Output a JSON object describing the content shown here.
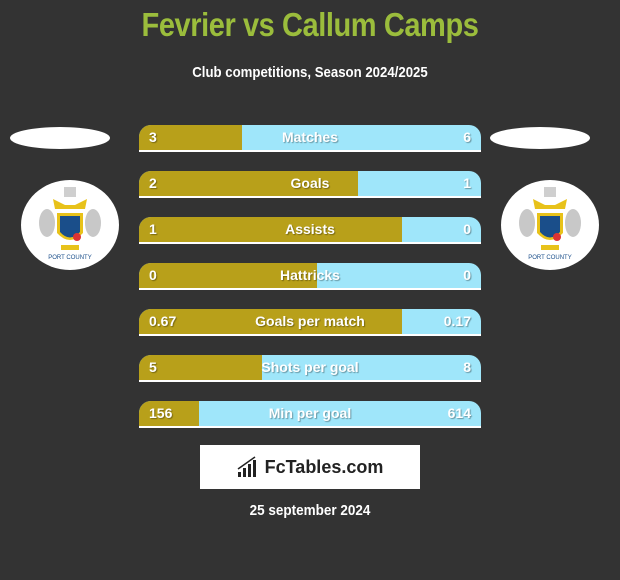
{
  "header": {
    "title": "Fevrier vs Callum Camps",
    "subtitle": "Club competitions, Season 2024/2025"
  },
  "colors": {
    "left_player": "#b8a01a",
    "right_player": "#9fe6fa",
    "title": "#9bbd3c",
    "background": "#333333"
  },
  "teams": {
    "left": {
      "logo": "stockport-county-crest",
      "label": "STOCKPORT COUNTY"
    },
    "right": {
      "logo": "stockport-county-crest",
      "label": "STOCKPORT COUNTY"
    }
  },
  "stats": [
    {
      "label": "Matches",
      "left": "3",
      "right": "6",
      "left_share": 0.3
    },
    {
      "label": "Goals",
      "left": "2",
      "right": "1",
      "left_share": 0.64
    },
    {
      "label": "Assists",
      "left": "1",
      "right": "0",
      "left_share": 0.77
    },
    {
      "label": "Hattricks",
      "left": "0",
      "right": "0",
      "left_share": 0.52
    },
    {
      "label": "Goals per match",
      "left": "0.67",
      "right": "0.17",
      "left_share": 0.77
    },
    {
      "label": "Shots per goal",
      "left": "5",
      "right": "8",
      "left_share": 0.36
    },
    {
      "label": "Min per goal",
      "left": "156",
      "right": "614",
      "left_share": 0.175
    }
  ],
  "brand": {
    "name": "FcTables.com",
    "icon": "bar-chart-icon"
  },
  "footer": {
    "date": "25 september 2024"
  }
}
